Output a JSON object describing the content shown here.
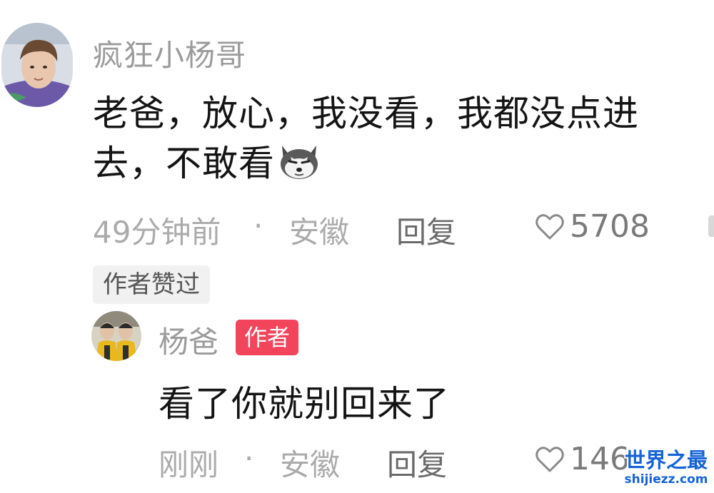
{
  "colors": {
    "background": "#ffffff",
    "primary_text": "#141414",
    "secondary_text": "#9b9b9b",
    "reply_text": "#6b6b6b",
    "author_tag": "#f2445a",
    "watermark": "#1663d6"
  },
  "comment": {
    "avatar_icon": "user-avatar-photo",
    "username": "疯狂小杨哥",
    "text_before_emoji": "老爸，放心，我没看，我都没点进去，不敢看",
    "emoji_icon": "husky-dog-emoji",
    "time": "49分钟前",
    "separator": "·",
    "location": "安徽",
    "reply_label": "回复",
    "like_icon": "heart-icon",
    "like_count": "5708",
    "author_liked_badge": "作者赞过"
  },
  "reply": {
    "avatar_icon": "user-avatar-photo",
    "username": "杨爸",
    "author_tag": "作者",
    "text": "看了你就别回来了",
    "time": "刚刚",
    "separator": "·",
    "location": "安徽",
    "reply_label": "回复",
    "like_icon": "heart-icon",
    "like_count": "146"
  },
  "watermark": {
    "title": "世界之最",
    "url": "shijiezz.com"
  }
}
